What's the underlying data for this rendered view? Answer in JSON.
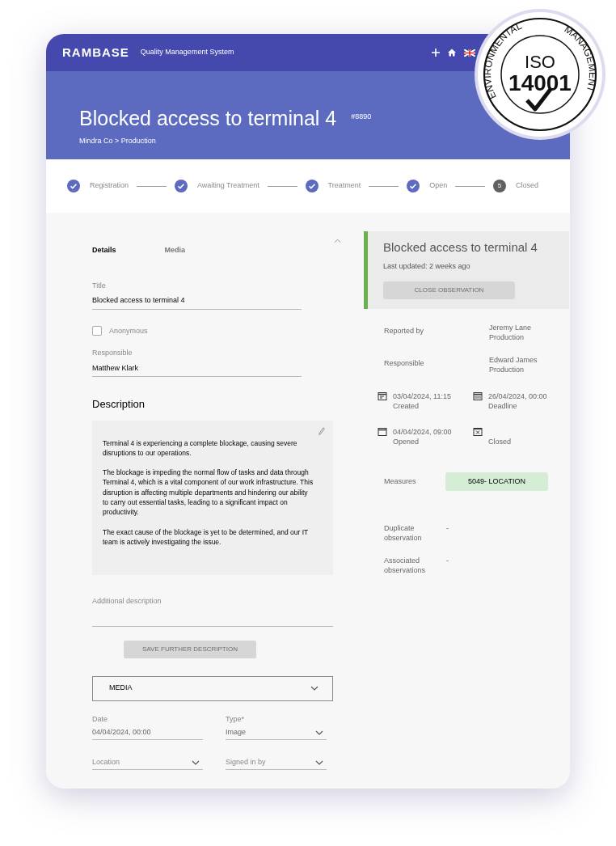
{
  "app": {
    "brand": "RAMBASE",
    "subtitle": "Quality Management System"
  },
  "seal": {
    "ring_words": [
      "ENVIRONMENTAL",
      "MANAGEMENT"
    ],
    "line1": "ISO",
    "line2": "14001"
  },
  "hero": {
    "title": "Blocked access to terminal 4",
    "number": "#8890",
    "breadcrumb": "Mindra Co > Production"
  },
  "steps": [
    {
      "label": "Registration",
      "done": true
    },
    {
      "label": "Awaiting Treatment",
      "done": true
    },
    {
      "label": "Treatment",
      "done": true
    },
    {
      "label": "Open",
      "done": true
    },
    {
      "label": "Closed",
      "done": false,
      "number": "5"
    }
  ],
  "tabs": [
    {
      "label": "Details",
      "selected": true
    },
    {
      "label": "Media",
      "selected": false
    }
  ],
  "title_field": {
    "label": "Title",
    "value": "Blocked access to terminal 4"
  },
  "anonymous": {
    "label": "Anonymous",
    "checked": false
  },
  "responsible_field": {
    "label": "Responsible",
    "value": "Matthew Klark"
  },
  "description": {
    "heading": "Description",
    "paragraphs": [
      "Terminal 4 is experiencing a complete blockage, causing severe disruptions to our operations.",
      "The blockage is impeding the normal flow of tasks and data through Terminal 4, which is a vital component of our work infrastructure. This disruption is affecting multiple departments and hindering our ability to carry out essential tasks, leading to a significant impact on productivity.",
      "The exact cause of the blockage is yet to be determined, and our IT team is actively investigating the issue."
    ]
  },
  "additional_description": {
    "placeholder": "Additional description"
  },
  "save_button": {
    "label": "SAVE FURTHER DESCRIPTION",
    "disabled": true
  },
  "media_section": {
    "label": "MEDIA"
  },
  "media_fields": [
    {
      "kind": "text",
      "label": "Date",
      "value": "04/04/2024, 00:00"
    },
    {
      "kind": "select",
      "label": "Type*",
      "value": "Image"
    },
    {
      "kind": "select",
      "placeholder": "Location"
    },
    {
      "kind": "select",
      "placeholder": "Signed in by"
    }
  ],
  "summary": {
    "title": "Blocked access to terminal 4",
    "updated": "Last updated: 2 weeks ago",
    "button": {
      "label": "CLOSE OBSERVATION",
      "disabled": true
    }
  },
  "people": [
    {
      "label": "Reported by",
      "name": "Jeremy Lane",
      "department": "Production"
    },
    {
      "label": "Responsible",
      "name": "Edward James",
      "department": "Production"
    }
  ],
  "dates": [
    {
      "kind": "created",
      "value": "03/04/2024, 11:15",
      "label": "Created"
    },
    {
      "kind": "deadline",
      "value": "26/04/2024, 00:00",
      "label": "Deadline"
    },
    {
      "kind": "opened",
      "value": "04/04/2024, 09:00",
      "label": "Opened"
    },
    {
      "kind": "closed",
      "label": "Closed"
    }
  ],
  "measures": {
    "label": "Measures",
    "tag": "5049- LOCATION"
  },
  "links": [
    {
      "label": "Duplicate observation",
      "value": "-"
    },
    {
      "label": "Associated observations",
      "value": "-"
    }
  ]
}
